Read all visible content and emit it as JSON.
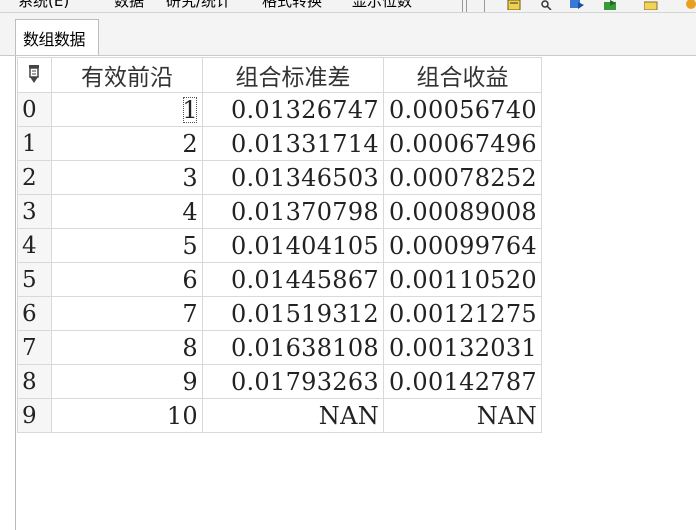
{
  "menu": {
    "items": [
      "系统(E)",
      "数据",
      "研究/统计",
      "格式转换",
      "显示位数"
    ]
  },
  "tab": {
    "label": "数组数据"
  },
  "table": {
    "columns": [
      "有效前沿",
      "组合标准差",
      "组合收益"
    ],
    "rows": [
      {
        "index": "0",
        "c1": "1",
        "c2": "0.01326747",
        "c3": "0.00056740"
      },
      {
        "index": "1",
        "c1": "2",
        "c2": "0.01331714",
        "c3": "0.00067496"
      },
      {
        "index": "2",
        "c1": "3",
        "c2": "0.01346503",
        "c3": "0.00078252"
      },
      {
        "index": "3",
        "c1": "4",
        "c2": "0.01370798",
        "c3": "0.00089008"
      },
      {
        "index": "4",
        "c1": "5",
        "c2": "0.01404105",
        "c3": "0.00099764"
      },
      {
        "index": "5",
        "c1": "6",
        "c2": "0.01445867",
        "c3": "0.00110520"
      },
      {
        "index": "6",
        "c1": "7",
        "c2": "0.01519312",
        "c3": "0.00121275"
      },
      {
        "index": "7",
        "c1": "8",
        "c2": "0.01638108",
        "c3": "0.00132031"
      },
      {
        "index": "8",
        "c1": "9",
        "c2": "0.01793263",
        "c3": "0.00142787"
      },
      {
        "index": "9",
        "c1": "10",
        "c2": "NAN",
        "c3": "NAN"
      }
    ]
  },
  "toolbar": {
    "icons": [
      "file-icon",
      "key-icon",
      "arrow-right-icon",
      "export-icon",
      "folder-icon",
      "globe-icon"
    ]
  }
}
